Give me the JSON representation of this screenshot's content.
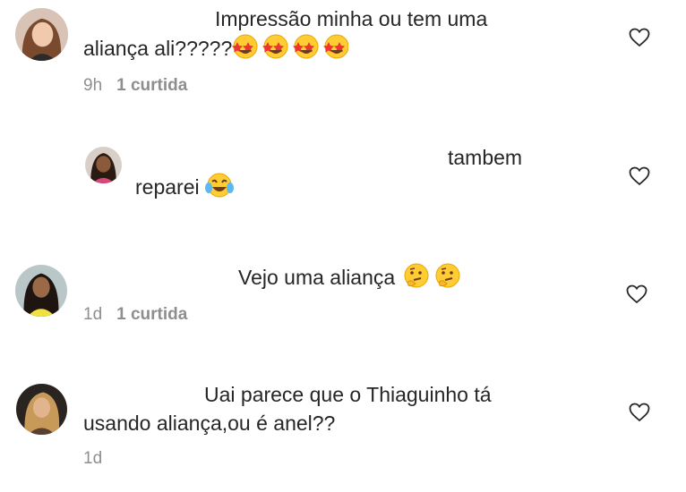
{
  "comments": [
    {
      "line1": "Impressão minha ou tem uma",
      "line2": "aliança ali?????",
      "emoji": "star-struck-emoji",
      "time": "9h",
      "likes": "1 curtida",
      "like_icon": "heart-outline-icon"
    },
    {
      "line1": "tambem",
      "line2": "reparei",
      "emoji": "tears-of-joy-emoji",
      "like_icon": "heart-outline-icon"
    },
    {
      "line1": "Vejo uma aliança",
      "emoji": "thinking-face-emoji",
      "time": "1d",
      "likes": "1 curtida",
      "like_icon": "heart-outline-icon"
    },
    {
      "line1": "Uai parece que o Thiaguinho tá",
      "line2": "usando aliança,ou é anel??",
      "time": "1d",
      "like_icon": "heart-outline-icon"
    }
  ],
  "colors": {
    "text": "#262626",
    "meta": "#8e8e8e",
    "emoji_face": "#ffcc33"
  }
}
